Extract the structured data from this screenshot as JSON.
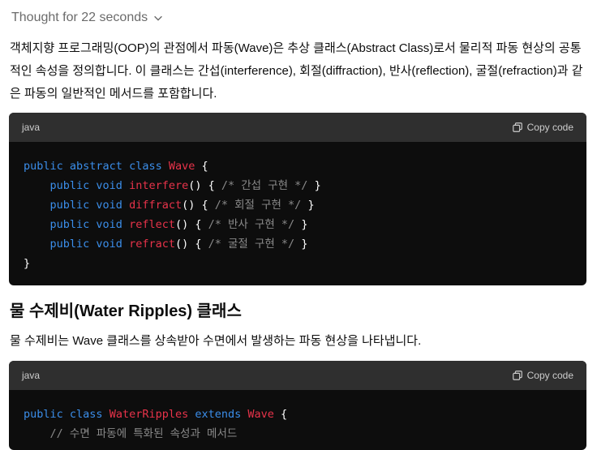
{
  "thought": {
    "label": "Thought for 22 seconds"
  },
  "para1": "객체지향 프로그래밍(OOP)의 관점에서 파동(Wave)은 추상 클래스(Abstract Class)로서 물리적 파동 현상의 공통적인 속성을 정의합니다. 이 클래스는 간섭(interference), 회절(diffraction), 반사(reflection), 굴절(refraction)과 같은 파동의 일반적인 메서드를 포함합니다.",
  "code1": {
    "lang": "java",
    "copy_label": "Copy code",
    "lines": [
      [
        [
          "kw",
          "public "
        ],
        [
          "kw",
          "abstract "
        ],
        [
          "kw",
          "class "
        ],
        [
          "tp",
          "Wave"
        ],
        [
          "",
          " {"
        ]
      ],
      [
        [
          "",
          "    "
        ],
        [
          "kw",
          "public "
        ],
        [
          "kw",
          "void "
        ],
        [
          "tp",
          "interfere"
        ],
        [
          "",
          "() { "
        ],
        [
          "cm",
          "/* 간섭 구현 */"
        ],
        [
          "",
          " }"
        ]
      ],
      [
        [
          "",
          "    "
        ],
        [
          "kw",
          "public "
        ],
        [
          "kw",
          "void "
        ],
        [
          "tp",
          "diffract"
        ],
        [
          "",
          "() { "
        ],
        [
          "cm",
          "/* 회절 구현 */"
        ],
        [
          "",
          " }"
        ]
      ],
      [
        [
          "",
          "    "
        ],
        [
          "kw",
          "public "
        ],
        [
          "kw",
          "void "
        ],
        [
          "tp",
          "reflect"
        ],
        [
          "",
          "() { "
        ],
        [
          "cm",
          "/* 반사 구현 */"
        ],
        [
          "",
          " }"
        ]
      ],
      [
        [
          "",
          "    "
        ],
        [
          "kw",
          "public "
        ],
        [
          "kw",
          "void "
        ],
        [
          "tp",
          "refract"
        ],
        [
          "",
          "() { "
        ],
        [
          "cm",
          "/* 굴절 구현 */"
        ],
        [
          "",
          " }"
        ]
      ],
      [
        [
          "",
          "}"
        ]
      ]
    ]
  },
  "heading": "물 수제비(Water Ripples) 클래스",
  "para2": "물 수제비는 Wave 클래스를 상속받아 수면에서 발생하는 파동 현상을 나타냅니다.",
  "code2": {
    "lang": "java",
    "copy_label": "Copy code",
    "lines": [
      [
        [
          "kw",
          "public "
        ],
        [
          "kw",
          "class "
        ],
        [
          "tp",
          "WaterRipples "
        ],
        [
          "kw",
          "extends "
        ],
        [
          "tp",
          "Wave"
        ],
        [
          "",
          " {"
        ]
      ],
      [
        [
          "",
          "    "
        ],
        [
          "cm",
          "// 수면 파동에 특화된 속성과 메서드"
        ]
      ]
    ]
  }
}
